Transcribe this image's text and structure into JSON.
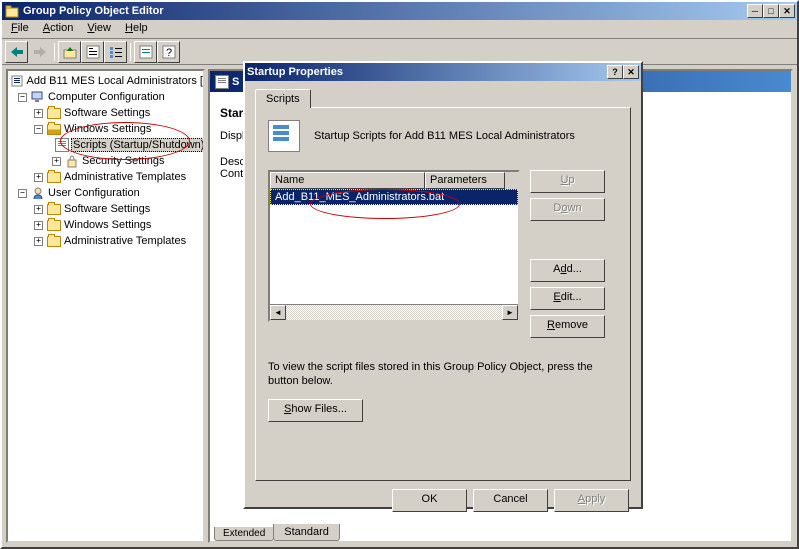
{
  "main_window": {
    "title": "Group Policy Object Editor",
    "menubar": [
      "File",
      "Action",
      "View",
      "Help"
    ],
    "tree": {
      "root": "Add B11 MES Local Administrators [",
      "computer_config": "Computer Configuration",
      "cc_software": "Software Settings",
      "cc_windows": "Windows Settings",
      "cc_scripts": "Scripts (Startup/Shutdown)",
      "cc_security": "Security Settings",
      "cc_admin": "Administrative Templates",
      "user_config": "User Configuration",
      "uc_software": "Software Settings",
      "uc_windows": "Windows Settings",
      "uc_admin": "Administrative Templates"
    },
    "content": {
      "heading": "Startup",
      "display_label": "Display",
      "desc_label": "Descript",
      "contain_label": "Contain"
    },
    "bottom_tabs": {
      "extended": "Extended",
      "standard": "Standard"
    }
  },
  "dialog": {
    "title": "Startup Properties",
    "tab": "Scripts",
    "info_text": "Startup Scripts for Add B11 MES Local Administrators",
    "columns": {
      "name": "Name",
      "params": "Parameters"
    },
    "list_item": "Add_B11_MES_Administrators.bat",
    "buttons": {
      "up": "Up",
      "down": "Down",
      "add": "Add...",
      "edit": "Edit...",
      "remove": "Remove",
      "show_files": "Show Files...",
      "ok": "OK",
      "cancel": "Cancel",
      "apply": "Apply"
    },
    "hint": "To view the script files stored in this Group Policy Object, press the button below."
  }
}
